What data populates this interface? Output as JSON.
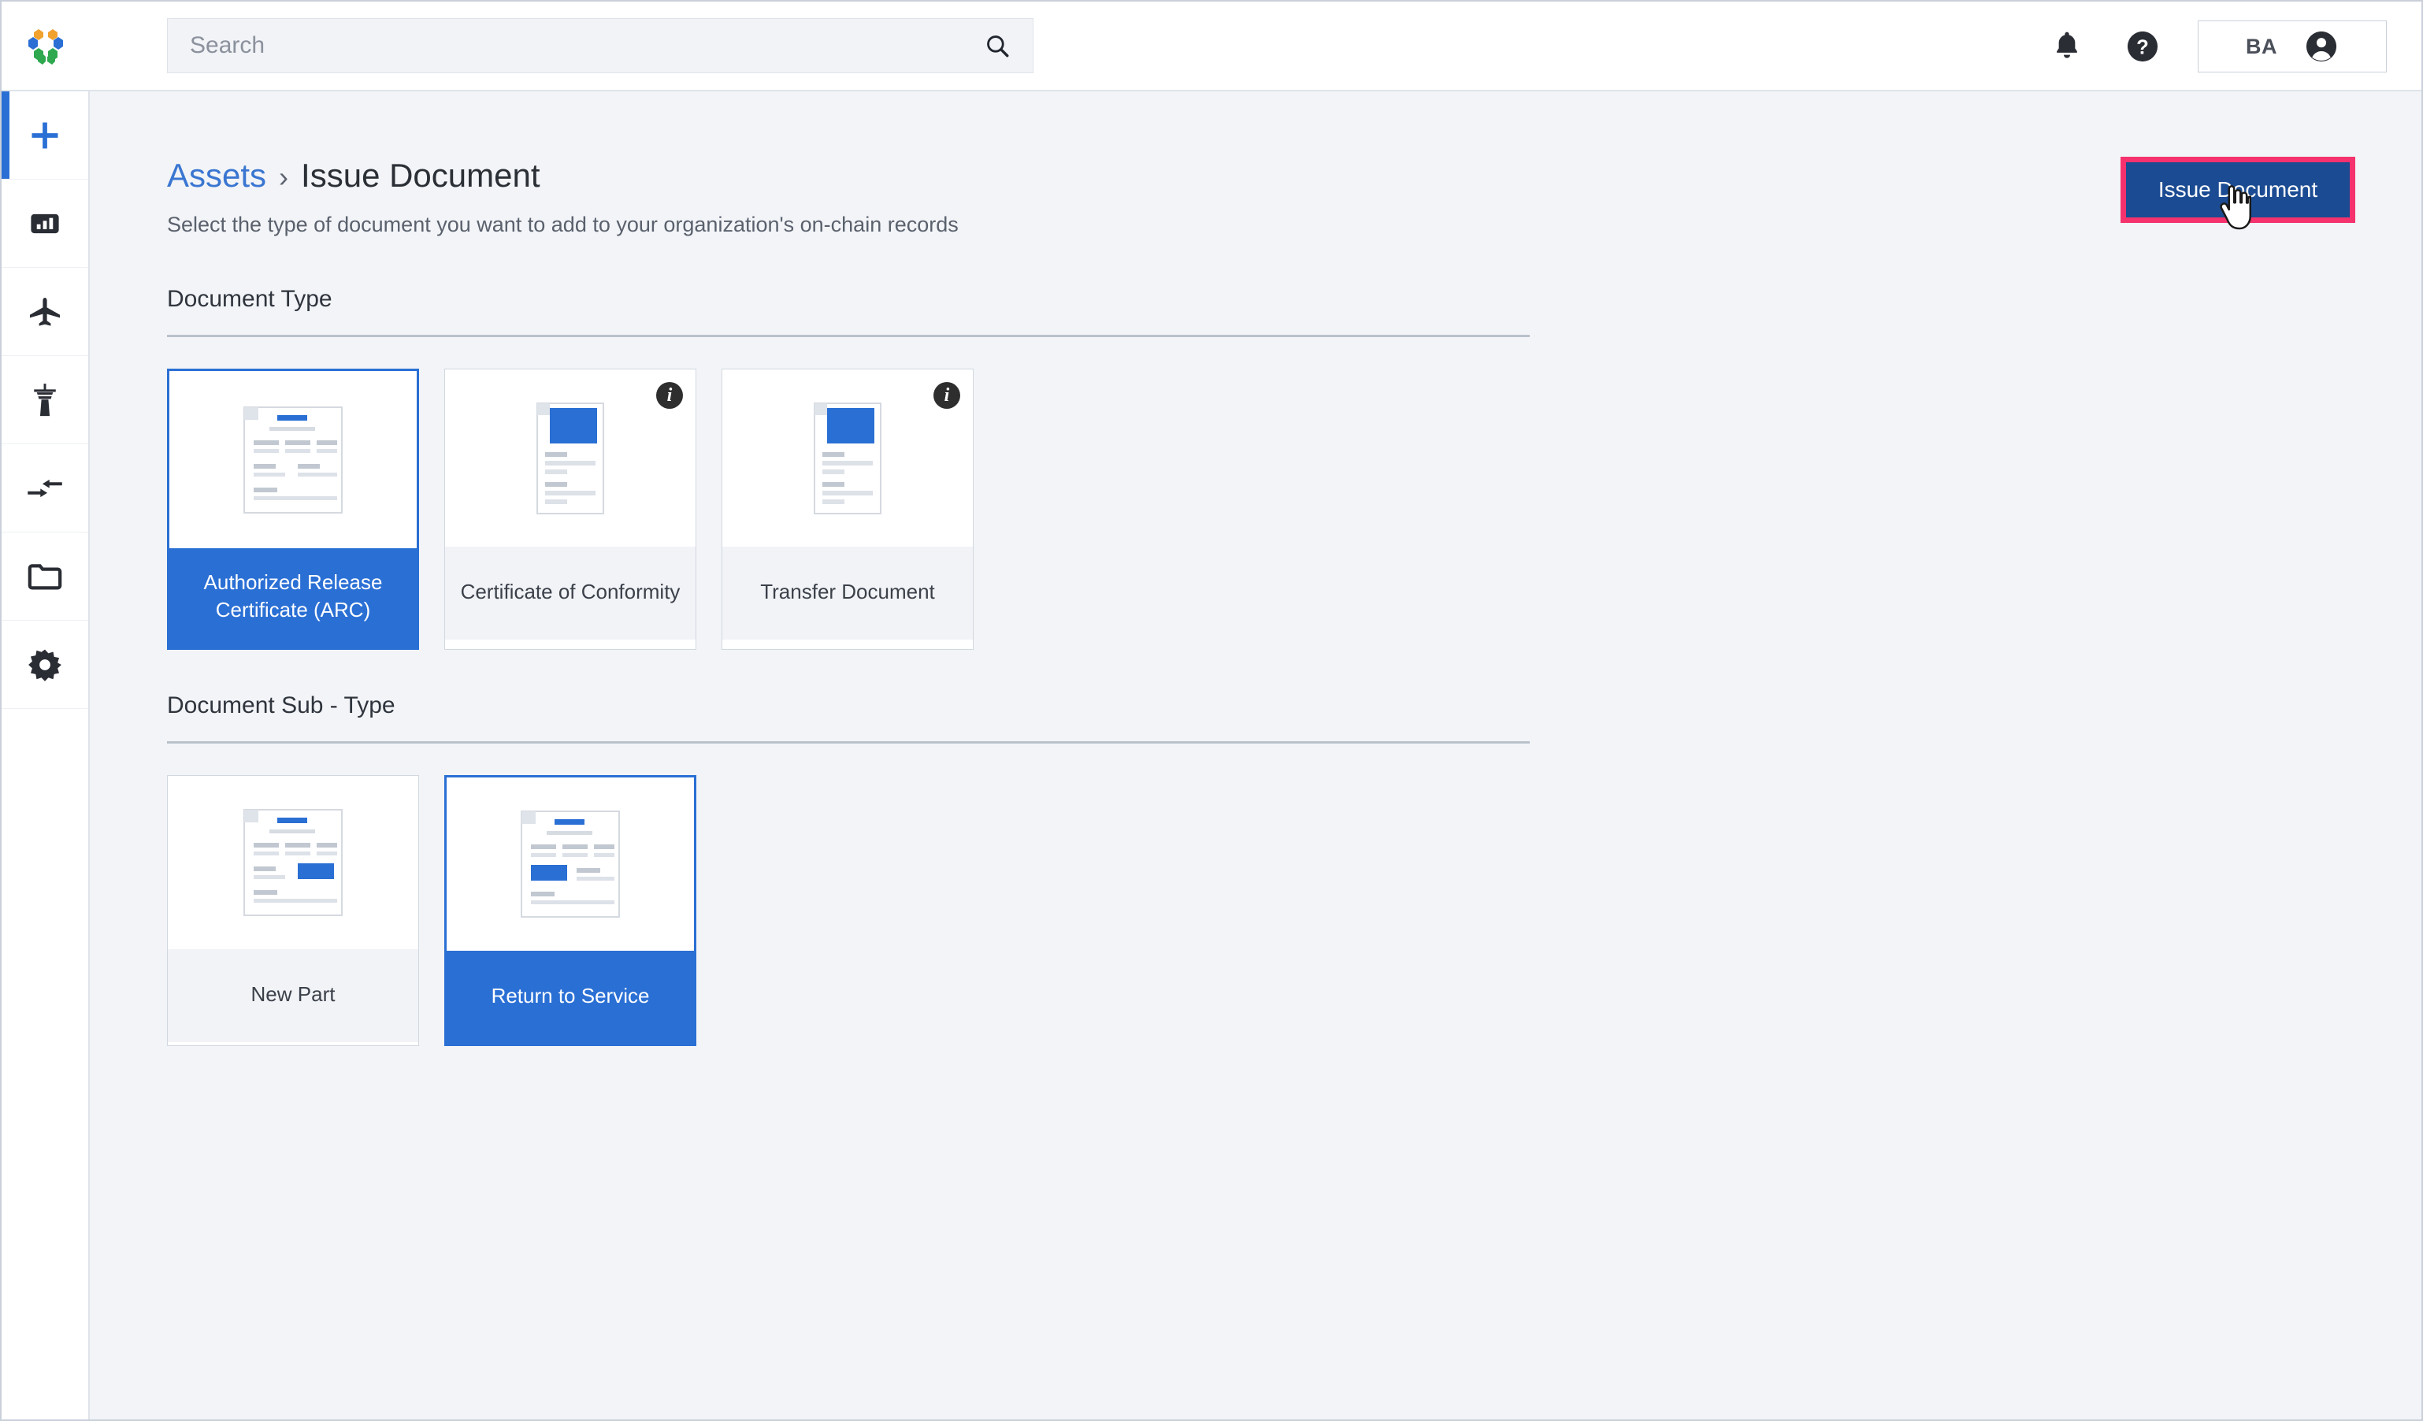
{
  "app": {
    "logo_name": "hexagon-logo",
    "accent_blue": "#2a6fd4",
    "button_blue": "#1b4b92",
    "highlight_pink": "#f5326d",
    "page_bg": "#f2f4f7"
  },
  "header": {
    "search": {
      "placeholder": "Search",
      "value": "",
      "icon": "search-icon"
    },
    "notifications_icon": "bell-icon",
    "help_icon": "help-circle-icon",
    "account": {
      "initials": "BA",
      "avatar_icon": "person-circle-icon"
    }
  },
  "sidebar": {
    "items": [
      {
        "name": "add",
        "icon": "plus-icon",
        "active": true
      },
      {
        "name": "dashboard",
        "icon": "chart-bar-icon",
        "active": false
      },
      {
        "name": "aircraft",
        "icon": "airplane-icon",
        "active": false
      },
      {
        "name": "control-tower",
        "icon": "control-tower-icon",
        "active": false
      },
      {
        "name": "transfers",
        "icon": "transfer-arrows-icon",
        "active": false
      },
      {
        "name": "documents",
        "icon": "folder-icon",
        "active": false
      },
      {
        "name": "settings",
        "icon": "gear-icon",
        "active": false
      }
    ]
  },
  "page": {
    "breadcrumb": {
      "parent": "Assets",
      "separator": "›",
      "current": "Issue Document"
    },
    "subtitle": "Select the type of document you want to add to your organization's on-chain records",
    "primary_action": {
      "label": "Issue Document",
      "highlighted": true
    }
  },
  "document_type": {
    "title": "Document Type",
    "cards": [
      {
        "label": "Authorized Release Certificate (ARC)",
        "selected": true,
        "has_info": false,
        "icon": "document-landscape-blue-title-icon"
      },
      {
        "label": "Certificate of Conformity",
        "selected": false,
        "has_info": true,
        "info_label": "i",
        "icon": "document-portrait-blue-block-icon"
      },
      {
        "label": "Transfer Document",
        "selected": false,
        "has_info": true,
        "info_label": "i",
        "icon": "document-portrait-blue-block-icon"
      }
    ]
  },
  "document_sub_type": {
    "title": "Document Sub - Type",
    "cards": [
      {
        "label": "New Part",
        "selected": false,
        "has_info": false,
        "icon": "document-landscape-blue-right-block-icon"
      },
      {
        "label": "Return to Service",
        "selected": true,
        "has_info": false,
        "icon": "document-landscape-blue-left-block-icon"
      }
    ]
  },
  "cursor": {
    "type": "pointer-hand"
  }
}
